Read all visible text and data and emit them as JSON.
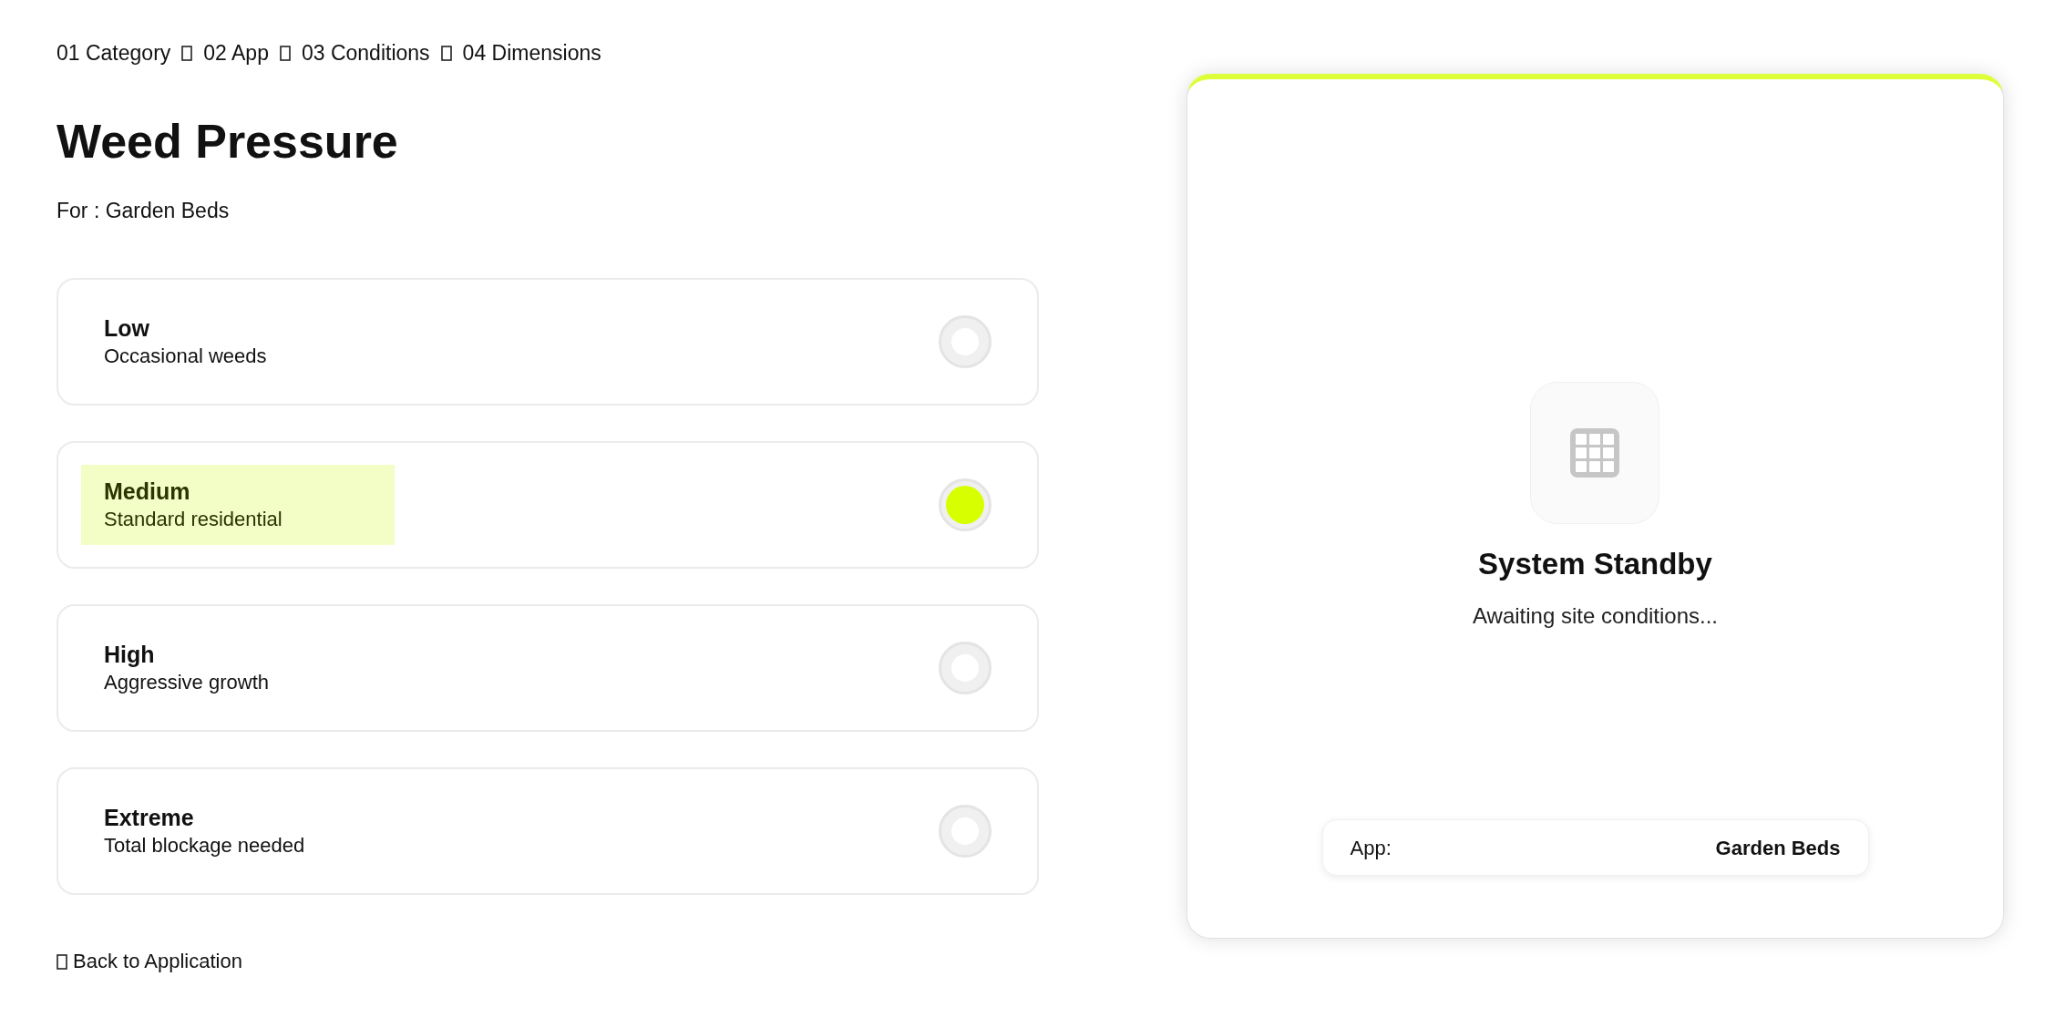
{
  "breadcrumb": [
    {
      "label": "01 Category"
    },
    {
      "label": "02 App"
    },
    {
      "label": "03 Conditions"
    },
    {
      "label": "04 Dimensions"
    }
  ],
  "heading": {
    "title": "Weed Pressure",
    "subtitle": "For : Garden Beds"
  },
  "options": [
    {
      "label": "Low",
      "description": "Occasional weeds",
      "selected": false
    },
    {
      "label": "Medium",
      "description": "Standard residential",
      "selected": true
    },
    {
      "label": "High",
      "description": "Aggressive growth",
      "selected": false
    },
    {
      "label": "Extreme",
      "description": "Total blockage needed",
      "selected": false
    }
  ],
  "back_link": {
    "label": "Back to Application"
  },
  "preview": {
    "title": "System Standby",
    "message": "Awaiting site conditions...",
    "summary": {
      "label": "App:",
      "value": "Garden Beds"
    }
  }
}
